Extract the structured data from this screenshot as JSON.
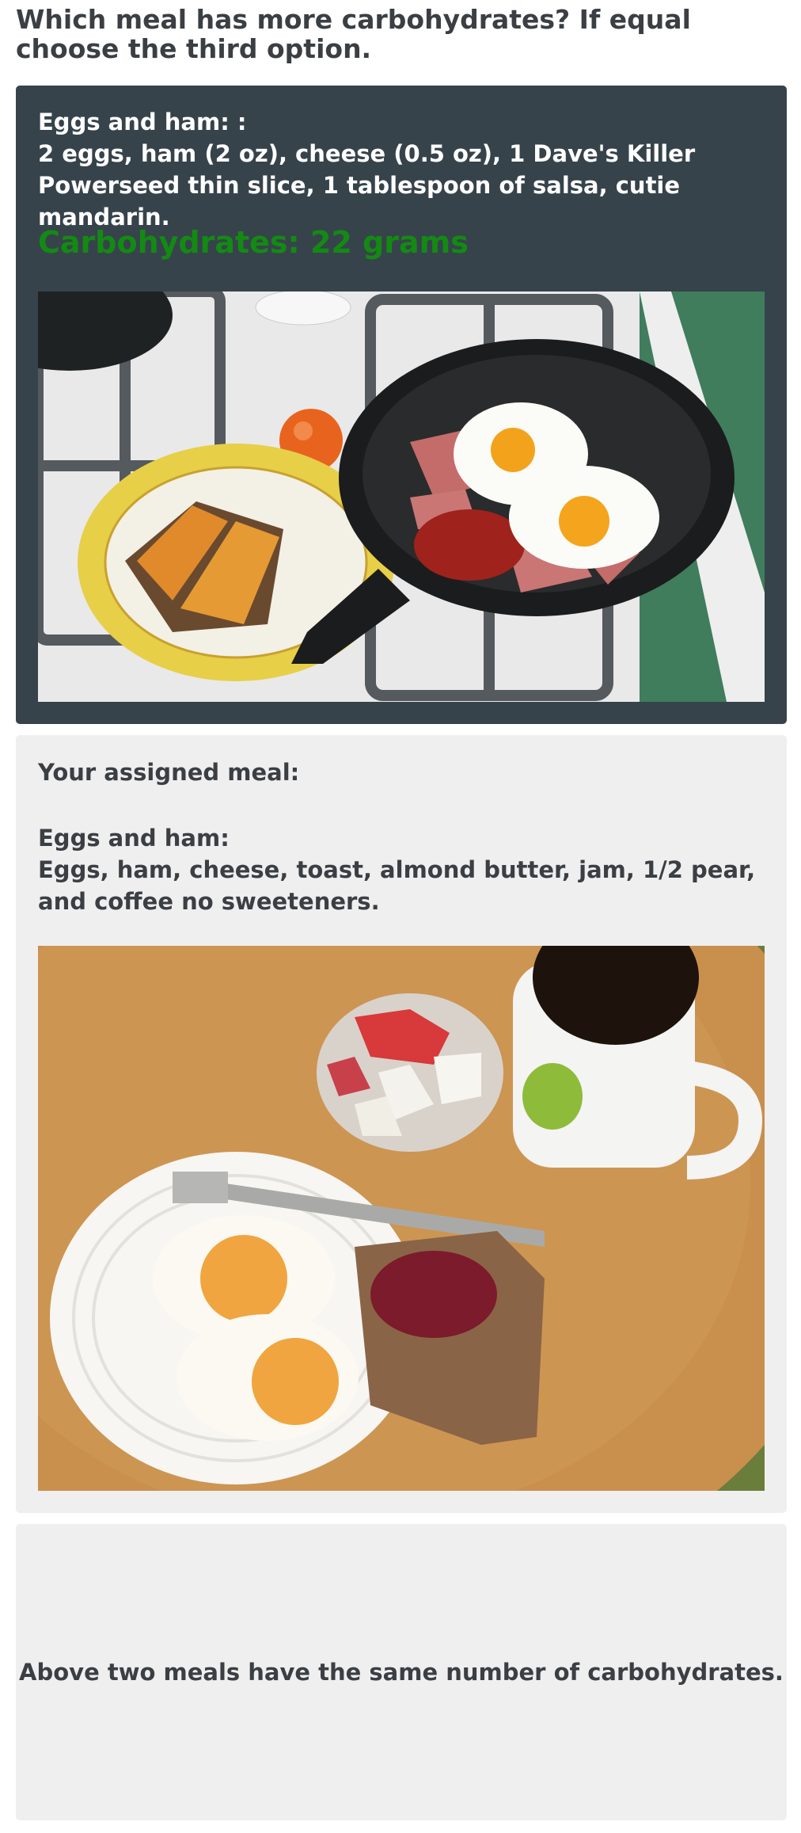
{
  "question": "Which meal has more carbohydrates? If equal choose the third option.",
  "option_a": {
    "title": "Eggs and ham: :",
    "description": "2 eggs, ham (2 oz), cheese (0.5 oz), 1 Dave's Killer Powerseed thin slice, 1 tablespoon of salsa, cutie mandarin.",
    "carbohydrates": "Carbohydrates: 22 grams",
    "carb_color": "#138a13"
  },
  "option_b": {
    "assigned_label": "Your assigned meal:",
    "title": "Eggs and ham:",
    "description": "Eggs, ham, cheese, toast, almond butter, jam, 1/2 pear, and coffee no sweeteners."
  },
  "option_c": {
    "text": "Above two meals have the same number of carbohydrates."
  },
  "colors": {
    "card_dark": "#37434b",
    "card_light": "#efefef",
    "text_dark": "#3b3f44"
  }
}
